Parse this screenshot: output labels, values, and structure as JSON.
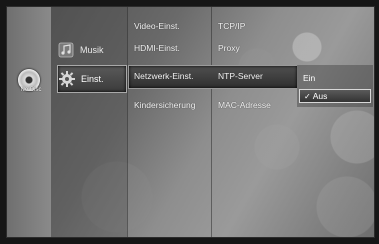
{
  "status": {
    "disc_label": "No Disc"
  },
  "main_menu": [
    {
      "label": "Musik",
      "icon": "music-icon",
      "selected": false
    },
    {
      "label": "Einst.",
      "icon": "gear-icon",
      "selected": true
    }
  ],
  "sub_menu": [
    {
      "label": "Video-Einst."
    },
    {
      "label": "HDMI-Einst."
    },
    {
      "label": "Netzwerk-Einst.",
      "selected": true
    },
    {
      "label": "Kindersicherung"
    }
  ],
  "option_menu": [
    {
      "label": "TCP/IP"
    },
    {
      "label": "Proxy"
    },
    {
      "label": "NTP-Server",
      "selected": true
    },
    {
      "label": "MAC-Adresse"
    }
  ],
  "popup": {
    "options": [
      {
        "label": "Ein",
        "checked": false
      },
      {
        "label": "Aus",
        "checked": true
      }
    ],
    "check_mark": "✓"
  }
}
